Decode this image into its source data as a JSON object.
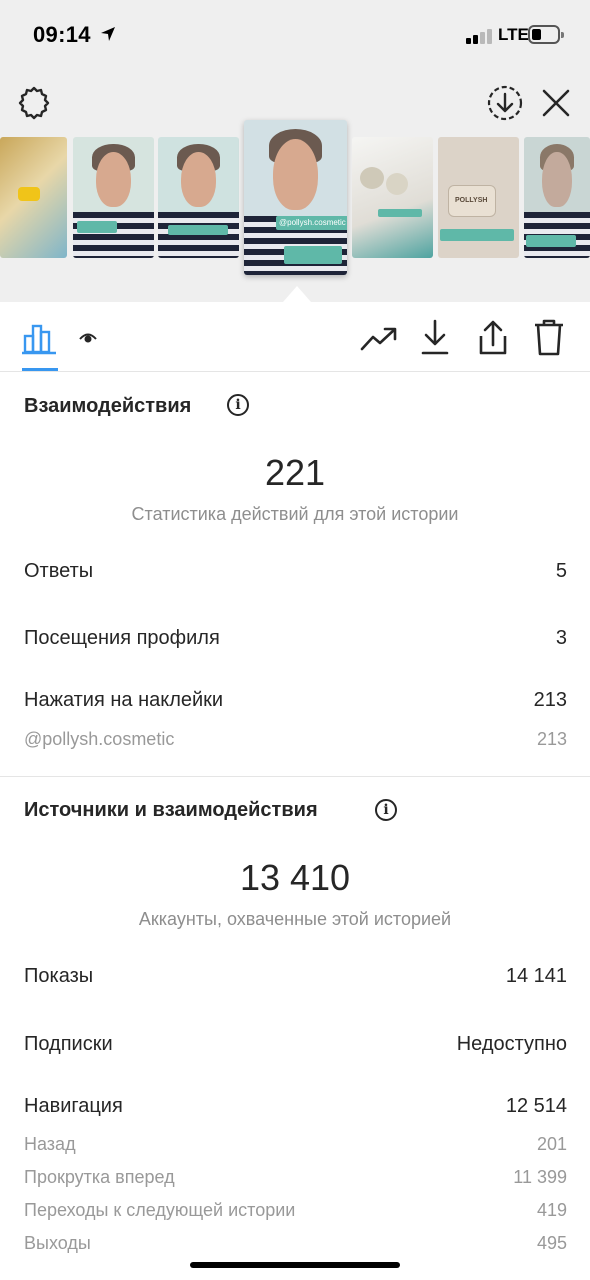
{
  "status_bar": {
    "time": "09:14",
    "network": "LTE"
  },
  "top_bar": {
    "settings_icon": "gear-icon",
    "download_icon": "download-circle-icon",
    "close_icon": "close-icon"
  },
  "stories": {
    "active_tag": "@pollysh.cosmetic",
    "thumbnails": [
      {
        "id": "t1",
        "tag": ""
      },
      {
        "id": "t2",
        "tag": ""
      },
      {
        "id": "t3",
        "tag": ""
      },
      {
        "id": "t4",
        "tag": "@pollysh.cosmetic"
      },
      {
        "id": "t5",
        "tag": ""
      },
      {
        "id": "t6",
        "tag": "POLLYSH"
      },
      {
        "id": "t7",
        "tag": ""
      }
    ]
  },
  "toolbar": {
    "tabs": [
      {
        "icon": "bar-chart-icon"
      },
      {
        "icon": "eye-icon"
      }
    ],
    "actions": [
      {
        "icon": "trending-up-icon"
      },
      {
        "icon": "download-icon"
      },
      {
        "icon": "share-icon"
      },
      {
        "icon": "trash-icon"
      }
    ]
  },
  "interactions": {
    "title": "Взаимодействия",
    "total": "221",
    "total_caption": "Статистика действий для этой истории",
    "rows": [
      {
        "label": "Ответы",
        "value": "5"
      },
      {
        "label": "Посещения профиля",
        "value": "3"
      },
      {
        "label": "Нажатия на наклейки",
        "value": "213"
      }
    ],
    "sub_rows": [
      {
        "label": "@pollysh.cosmetic",
        "value": "213"
      }
    ]
  },
  "discovery": {
    "title": "Источники и взаимодействия",
    "total": "13 410",
    "total_caption": "Аккаунты, охваченные этой историей",
    "rows": [
      {
        "label": "Показы",
        "value": "14 141"
      },
      {
        "label": "Подписки",
        "value": "Недоступно"
      },
      {
        "label": "Навигация",
        "value": "12 514"
      }
    ],
    "sub_rows": [
      {
        "label": "Назад",
        "value": "201"
      },
      {
        "label": "Прокрутка вперед",
        "value": "11 399"
      },
      {
        "label": "Переходы к следующей истории",
        "value": "419"
      },
      {
        "label": "Выходы",
        "value": "495"
      }
    ]
  },
  "colors": {
    "accent": "#3897f0",
    "text": "#262626",
    "muted": "#8e8e8e",
    "top_bg": "#efefef"
  }
}
